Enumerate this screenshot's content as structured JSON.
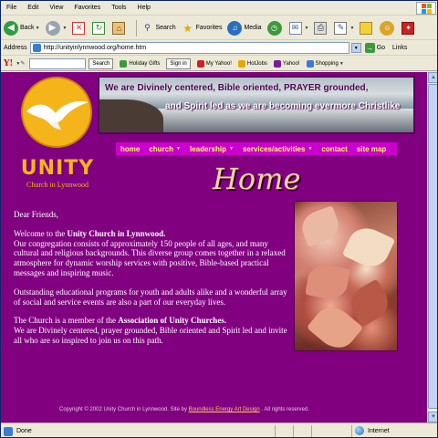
{
  "browser": {
    "menu": [
      "File",
      "Edit",
      "View",
      "Favorites",
      "Tools",
      "Help"
    ],
    "toolbar": {
      "back": "Back",
      "search": "Search",
      "favorites": "Favorites",
      "media": "Media"
    },
    "address": {
      "label": "Address",
      "url": "http://unityinlynnwood.org/home.htm",
      "go": "Go",
      "links": "Links"
    },
    "yahoo": {
      "logo": "Y!",
      "search_btn": "Search",
      "holiday_gifts": "Holiday Gifts",
      "sign_in": "Sign in",
      "my_yahoo": "My Yahoo!",
      "hotjobs": "HotJobs",
      "yahoo": "Yahoo!",
      "shopping": "Shopping"
    },
    "status": {
      "text": "Done",
      "zone": "Internet"
    }
  },
  "page": {
    "logo": {
      "name": "UNITY",
      "sub": "Church in Lynnwood"
    },
    "banner": {
      "line1": "We are Divinely centered, Bible oriented, PRAYER grounded,",
      "line2": "and Spirit led as we are becoming evermore Christlike"
    },
    "nav": [
      {
        "label": "home",
        "caret": ""
      },
      {
        "label": "church",
        "caret": "▼"
      },
      {
        "label": "leadership",
        "caret": "▼"
      },
      {
        "label": "services/activities",
        "caret": "▼"
      },
      {
        "label": "contact",
        "caret": ""
      },
      {
        "label": "site map",
        "caret": ""
      }
    ],
    "title": "Home",
    "greeting": "Dear Friends,",
    "p1_pre": "Welcome to the ",
    "p1_bold": "Unity Church in Lynnwood.",
    "p1_rest": "Our congregation consists of approximately 150 people of all ages, and many cultural and religious backgrounds.  This diverse group comes together in a relaxed atmosphere for dynamic worship services with positive, Bible-based practical messages and inspiring music.",
    "p2": "Outstanding educational programs for youth and adults alike and a wonderful array of social and service events are also a part of our everyday lives.",
    "p3_pre": "The Church is a member of the ",
    "p3_bold": "Association of Unity Churches.",
    "p3_rest": "  We are Divinely centered, prayer grounded, Bible oriented and Spirit led and invite all who are so inspired to join us on this path.",
    "footer_pre": "Copyright © 2002 Unity Church in Lynnwood.  Site by ",
    "footer_link": "Boundless Energy Art Design",
    "footer_post": " . All rights reserved."
  },
  "colors": {
    "page_bg": "#800080",
    "nav_bg": "#cc00cc",
    "nav_text": "#ffff66",
    "logo_gold": "#f5b51a"
  }
}
